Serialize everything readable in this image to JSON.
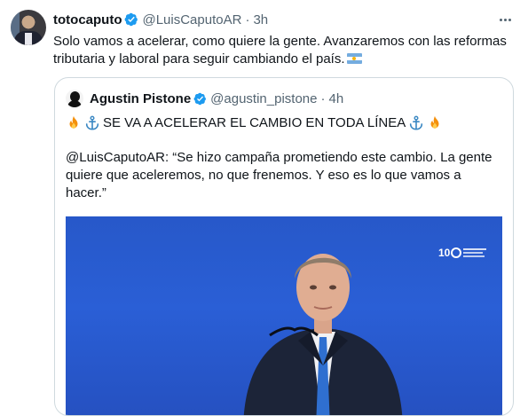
{
  "tweet": {
    "author_name": "totocaputo",
    "author_handle": "@LuisCaputoAR",
    "separator": "·",
    "time": "3h",
    "text": "Solo vamos a acelerar, como quiere la gente. Avanzaremos con las reformas tributaria y laboral para seguir cambiando el país."
  },
  "quoted": {
    "author_name": "Agustin Pistone",
    "author_handle": "@agustin_pistone",
    "separator": "·",
    "time": "4h",
    "headline": "SE VA A ACELERAR EL CAMBIO EN TODA LÍNEA",
    "body": "@LuisCaputoAR: “Se hizo campaña prometiendo este cambio. La gente quiere que aceleremos, no que frenemos. Y eso es lo que vamos a hacer.”"
  },
  "icons": {
    "verified": "verified-badge-icon",
    "more": "more-options-icon",
    "fire": "fire-emoji",
    "anchor": "anchor-emoji",
    "flag": "argentina-flag-emoji"
  },
  "colors": {
    "verified_blue": "#1d9bf0",
    "secondary_text": "#536471",
    "border": "#cfd9de",
    "media_background": "#2a5fd6"
  }
}
